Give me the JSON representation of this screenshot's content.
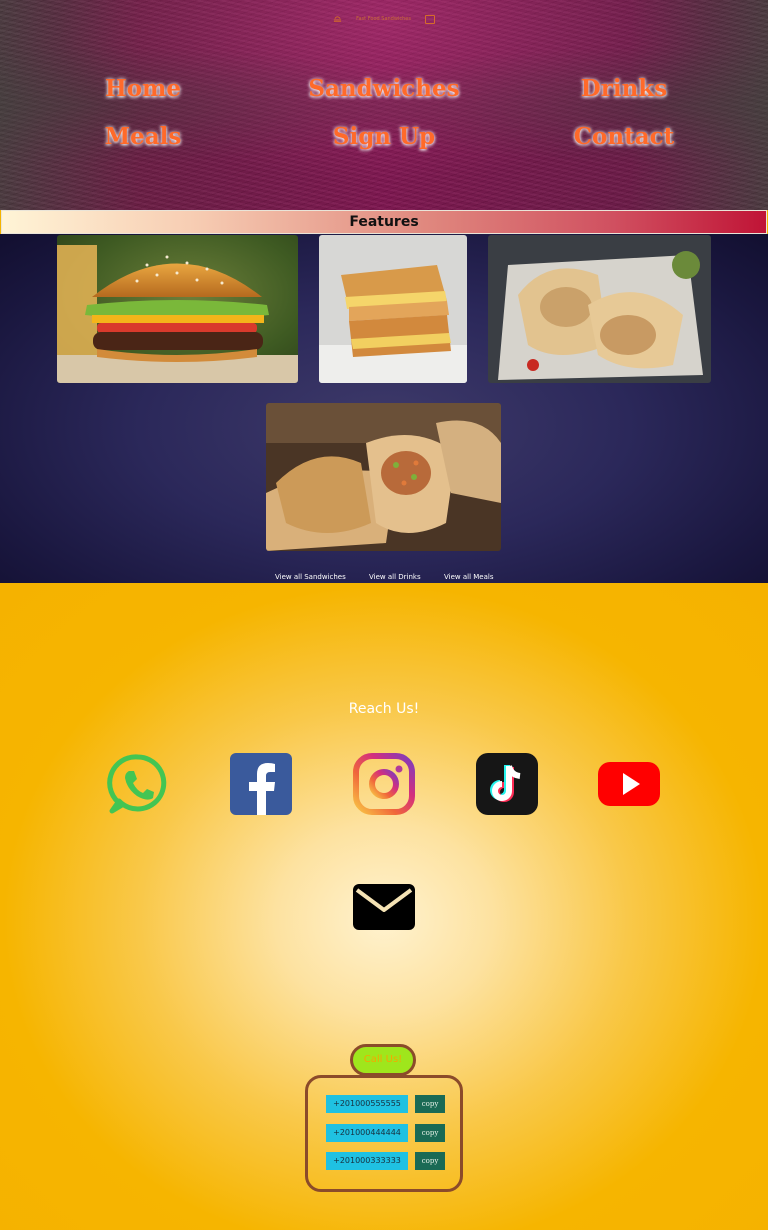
{
  "header": {
    "brand": "Fast Food Sandwiches",
    "logo_icon": "burger-logo-icon",
    "cart_icon": "cart-icon",
    "nav": [
      {
        "label": "Home"
      },
      {
        "label": "Sandwiches"
      },
      {
        "label": "Drinks"
      },
      {
        "label": "Meals"
      },
      {
        "label": "Sign Up"
      },
      {
        "label": "Contact"
      }
    ],
    "accent_color": "#ff6a2a"
  },
  "features": {
    "title": "Features",
    "images": [
      {
        "subject": "burger"
      },
      {
        "subject": "grilled-cheese-sandwich"
      },
      {
        "subject": "chicken-wrap"
      },
      {
        "subject": "burrito"
      }
    ],
    "links": [
      {
        "label": "View all Sandwiches"
      },
      {
        "label": "View all Drinks"
      },
      {
        "label": "View all Meals"
      }
    ]
  },
  "contact": {
    "title": "Reach Us!",
    "socials": [
      {
        "name": "whatsapp-icon"
      },
      {
        "name": "facebook-icon"
      },
      {
        "name": "instagram-icon"
      },
      {
        "name": "tiktok-icon"
      },
      {
        "name": "youtube-icon"
      },
      {
        "name": "mail-icon"
      }
    ],
    "call_label": "Call Us!",
    "copy_label": "copy",
    "phones": [
      {
        "number": "+201000555555"
      },
      {
        "number": "+201000444444"
      },
      {
        "number": "+201000333333"
      }
    ]
  }
}
